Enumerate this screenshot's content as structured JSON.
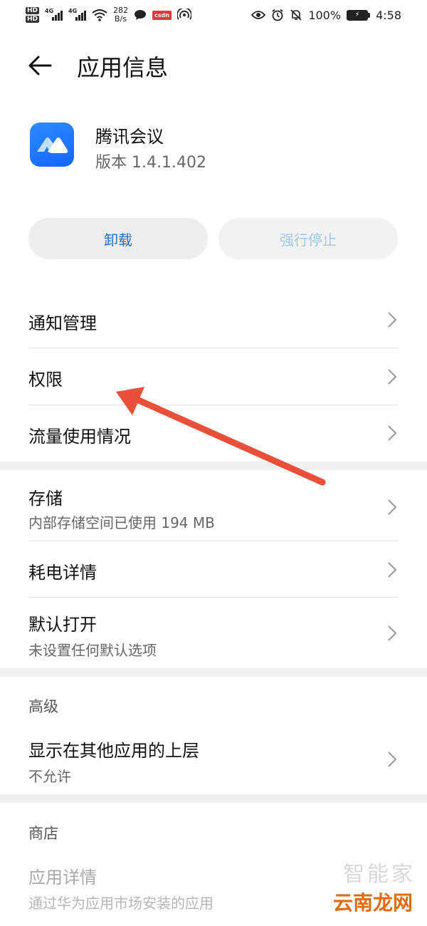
{
  "status_bar": {
    "hd_top": "HD",
    "hd_bottom": "HD",
    "net1": "4G",
    "net2": "4G",
    "speed_value": "282",
    "speed_unit": "B/s",
    "notif_badge": "csdn",
    "battery_percent": "100%",
    "time": "4:58"
  },
  "header": {
    "title": "应用信息"
  },
  "app": {
    "name": "腾讯会议",
    "version": "版本 1.4.1.402",
    "icon_color": "#1f7bff"
  },
  "actions": {
    "uninstall_label": "卸载",
    "force_stop_label": "强行停止"
  },
  "list": {
    "notification": "通知管理",
    "permissions": "权限",
    "data_usage": "流量使用情况",
    "storage": "存储",
    "storage_sub": "内部存储空间已使用 194 MB",
    "battery_usage": "耗电详情",
    "open_by_default": "默认打开",
    "open_by_default_sub": "未设置任何默认选项"
  },
  "advanced": {
    "label": "高级",
    "display_over": "显示在其他应用的上层",
    "display_over_sub": "不允许"
  },
  "store": {
    "label": "商店",
    "app_details": "应用详情",
    "app_details_sub": "通过华为应用市场安装的应用"
  },
  "annotation": {
    "arrow_color": "#e8503a"
  },
  "watermark": {
    "top": "智能家",
    "bottom": "云南龙网"
  }
}
